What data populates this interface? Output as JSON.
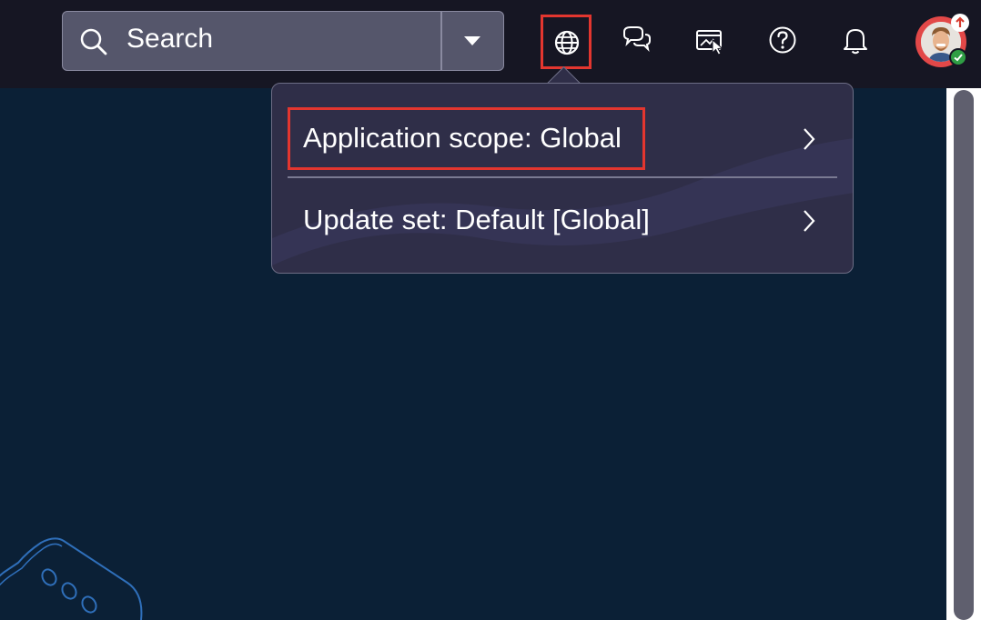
{
  "header": {
    "search": {
      "label": "Search",
      "icon": "search-icon",
      "dropdown_icon": "caret-down-icon"
    },
    "icons": [
      {
        "name": "globe-icon",
        "highlighted": true
      },
      {
        "name": "chat-icon"
      },
      {
        "name": "screen-capture-icon"
      },
      {
        "name": "help-icon"
      },
      {
        "name": "bell-icon"
      }
    ],
    "avatar": {
      "icon": "user-avatar",
      "badges": [
        "upload-arrow-badge",
        "online-check-badge"
      ]
    }
  },
  "popover": {
    "items": [
      {
        "label": "Application scope: Global",
        "highlighted": true
      },
      {
        "label": "Update set: Default [Global]",
        "highlighted": false
      }
    ]
  },
  "colors": {
    "topbar": "#161623",
    "page": "#0b2036",
    "popover": "#2f2e48",
    "highlight": "#e3362f"
  }
}
